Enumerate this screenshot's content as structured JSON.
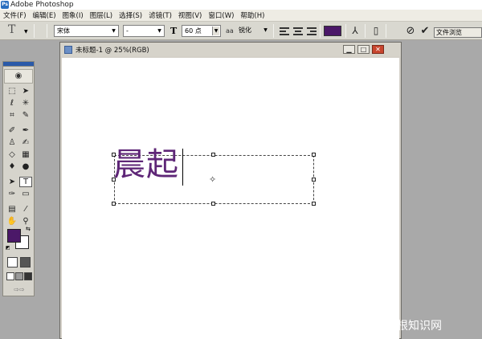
{
  "app": {
    "title": "Adobe Photoshop",
    "icon": "photoshop-app-icon"
  },
  "menu": [
    "文件(F)",
    "编辑(E)",
    "图象(I)",
    "图层(L)",
    "选择(S)",
    "滤镜(T)",
    "视图(V)",
    "窗口(W)",
    "帮助(H)"
  ],
  "options": {
    "tool_glyph": "T",
    "font_family": "宋体",
    "font_style": "-",
    "font_size": "60 点",
    "aa_label": "aa",
    "antialias": "锐化",
    "text_color": "#4b1868",
    "palette_tab": "文件浏览"
  },
  "toolbox": {
    "foreground_color": "#4b1868",
    "background_color": "#ffffff"
  },
  "document": {
    "title": "未标题-1 @ 25%(RGB)",
    "typed_text": "晨起",
    "text_color": "#5e2677"
  },
  "watermark": "爱创根知识网"
}
